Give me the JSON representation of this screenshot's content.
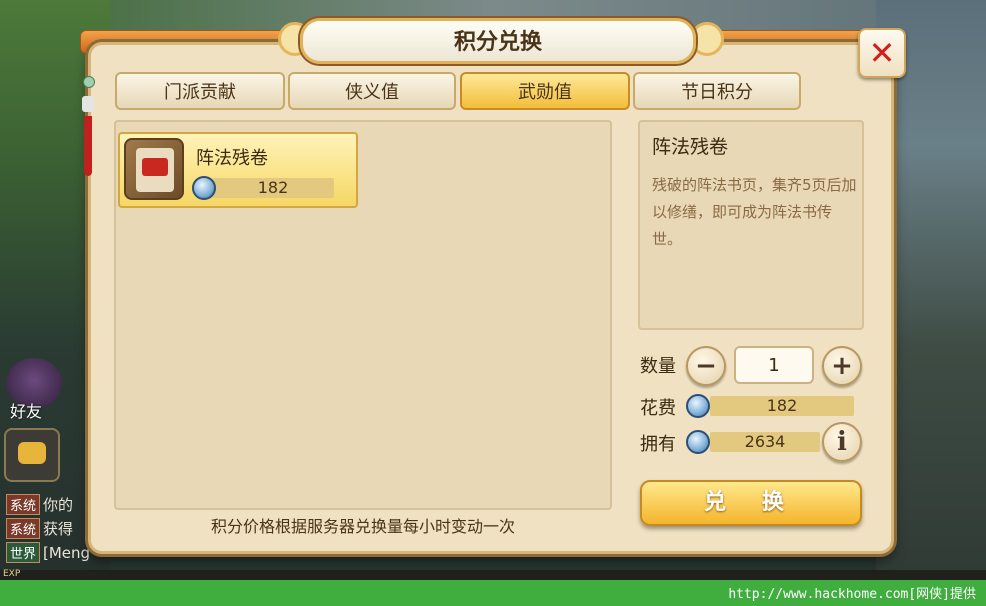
{
  "dialog": {
    "title": "积分兑换",
    "close_icon": "close-icon"
  },
  "tabs": [
    {
      "label": "门派贡献",
      "active": false
    },
    {
      "label": "侠义值",
      "active": false
    },
    {
      "label": "武勋值",
      "active": true
    },
    {
      "label": "节日积分",
      "active": false
    }
  ],
  "items": [
    {
      "name": "阵法残卷",
      "price": "182",
      "icon": "scroll-icon",
      "currency_icon": "silver-coin-icon",
      "selected": true
    }
  ],
  "hint": "积分价格根据服务器兑换量每小时变动一次",
  "detail": {
    "title": "阵法残卷",
    "description": "残破的阵法书页，集齐5页后加以修缮，即可成为阵法书传世。"
  },
  "purchase": {
    "quantity_label": "数量",
    "quantity": "1",
    "cost_label": "花费",
    "cost": "182",
    "owned_label": "拥有",
    "owned": "2634",
    "exchange_label": "兑 换",
    "minus_icon": "minus-icon",
    "plus_icon": "plus-icon",
    "info_icon": "info-icon"
  },
  "hud": {
    "friend_label": "好友",
    "chat_lines": [
      {
        "tag": "系统",
        "text": "你的"
      },
      {
        "tag": "系统",
        "text": "获得"
      },
      {
        "tag": "世界",
        "text": "[Meng丶"
      }
    ],
    "exp_label": "EXP"
  },
  "footer": {
    "text": "http://www.hackhome.com[网侠]提供"
  },
  "colors": {
    "accent": "#f2be3a",
    "title_bar": "#d26d1e",
    "close": "#d41e1e",
    "footer": "#3fae3f"
  }
}
